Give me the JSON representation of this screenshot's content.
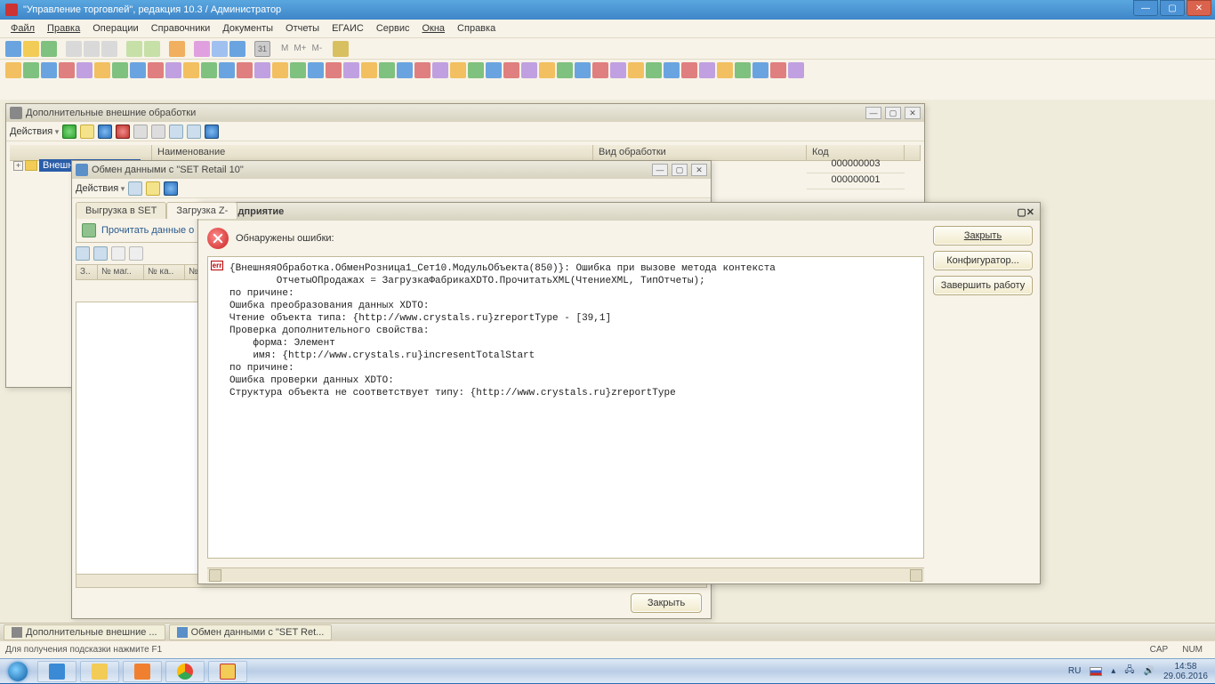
{
  "os_title": "\"Управление торговлей\", редакция 10.3 / Администратор",
  "menubar": [
    "Файл",
    "Правка",
    "Операции",
    "Справочники",
    "Документы",
    "Отчеты",
    "ЕГАИС",
    "Сервис",
    "Окна",
    "Справка"
  ],
  "child1": {
    "title": "Дополнительные внешние обработки",
    "actions": "Действия",
    "tree_item": "Внешние обработк...",
    "columns": {
      "name": "Наименование",
      "type": "Вид обработки",
      "code": "Код"
    },
    "codes": [
      "000000003",
      "000000001"
    ]
  },
  "child2": {
    "title": "Обмен данными с \"SET Retail 10\"",
    "actions": "Действия",
    "tabs": {
      "t1": "Выгрузка в SET",
      "t2": "Загрузка Z-"
    },
    "read_btn": "Прочитать данные о про",
    "small_cols": {
      "c0": "З..",
      "c1": "№ маг..",
      "c2": "№ ка..",
      "c3": "№ см"
    },
    "close": "Закрыть"
  },
  "dialog": {
    "title": "1С:Предприятие",
    "errors_found": "Обнаружены ошибки:",
    "btn_close": "Закрыть",
    "btn_config": "Конфигуратор...",
    "btn_end": "Завершить работу",
    "err_text": "{ВнешняяОбработка.ОбменРозница1_Сет10.МодульОбъекта(850)}: Ошибка при вызове метода контекста\n        ОтчетыОПродажах = ЗагрузкаФабрикаXDTO.ПрочитатьXML(ЧтениеXML, ТипОтчеты);\nпо причине:\nОшибка преобразования данных XDTO:\nЧтение объекта типа: {http://www.crystals.ru}zreportType - [39,1]\nПроверка дополнительного свойства:\n    форма: Элемент\n    имя: {http://www.crystals.ru}incresentTotalStart\nпо причине:\nОшибка проверки данных XDTO:\nСтруктура объекта не соответствует типу: {http://www.crystals.ru}zreportType"
  },
  "taskstrip": {
    "a": "Дополнительные внешние ...",
    "b": "Обмен данными с \"SET Ret..."
  },
  "statusbar": {
    "hint": "Для получения подсказки нажмите F1",
    "cap": "CAP",
    "num": "NUM"
  },
  "tray": {
    "lang": "RU",
    "time": "14:58",
    "date": "29.06.2016"
  }
}
